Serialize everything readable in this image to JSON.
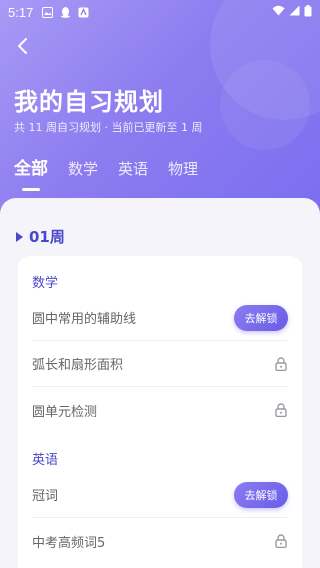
{
  "status_bar": {
    "time": "5:17"
  },
  "header": {
    "title": "我的自习规划",
    "subtitle": "共 11 周自习规划 · 当前已更新至 1 周"
  },
  "tabs": [
    {
      "label": "全部",
      "active": true
    },
    {
      "label": "数学",
      "active": false
    },
    {
      "label": "英语",
      "active": false
    },
    {
      "label": "物理",
      "active": false
    }
  ],
  "week": {
    "label": "01周"
  },
  "sections": [
    {
      "title": "数学",
      "items": [
        {
          "label": "圆中常用的辅助线",
          "action": "去解锁"
        },
        {
          "label": "弧长和扇形面积",
          "action": "lock-icon"
        },
        {
          "label": "圆单元检测",
          "action": "lock-icon"
        }
      ]
    },
    {
      "title": "英语",
      "items": [
        {
          "label": "冠词",
          "action": "去解锁"
        },
        {
          "label": "中考高频词5",
          "action": "lock-icon"
        }
      ]
    }
  ],
  "colors": {
    "accent": "#4b47c9",
    "header_start": "#a89af5",
    "header_end": "#7a6ef0"
  }
}
